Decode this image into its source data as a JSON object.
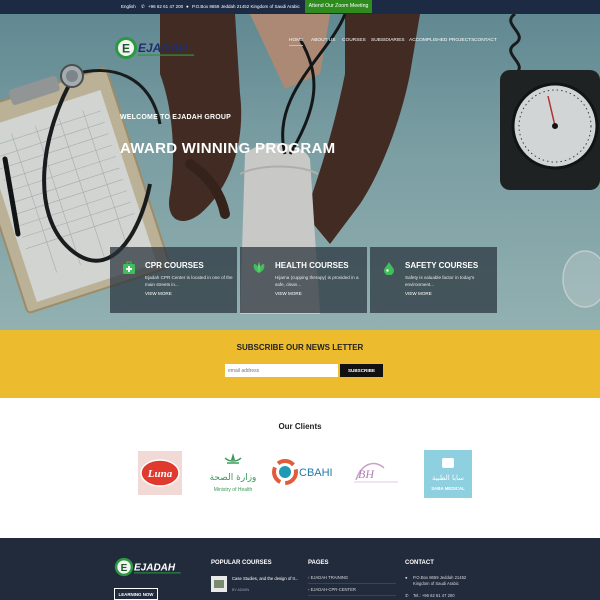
{
  "topbar": {
    "language": "English",
    "phone": "+96 62 61 47 200",
    "address": "P.O.Box 8659 Jeddah 21452 Kingdom of Saudi Arabic",
    "zoom_button": "Attend Our Zoom Meeting"
  },
  "brand": {
    "name": "EJADAH"
  },
  "nav": {
    "items": [
      {
        "label": "HOME"
      },
      {
        "label": "ABOUT US"
      },
      {
        "label": "COURSES"
      },
      {
        "label": "SUBSIDIARIES"
      },
      {
        "label": "ACCOMPLISHED PROJECTS"
      },
      {
        "label": "CONTACT"
      }
    ]
  },
  "hero": {
    "welcome": "WELCOME TO EJADAH GROUP",
    "headline": "AWARD WINNING PROGRAM"
  },
  "cards": [
    {
      "title": "CPR COURSES",
      "desc": "Ejadah CPR Center is located in one of the main streets in...",
      "more": "VIEW MORE",
      "icon": "first-aid-kit-icon"
    },
    {
      "title": "HEALTH COURSES",
      "desc": "Hijama (cupping therapy) is provided in a safe, clean...",
      "more": "VIEW MORE",
      "icon": "leaf-icon"
    },
    {
      "title": "SAFETY COURSES",
      "desc": "Safety is valuable factor in today's environment...",
      "more": "VIEW MORE",
      "icon": "drop-icon"
    }
  ],
  "newsletter": {
    "title": "SUBSCRIBE OUR NEWS LETTER",
    "placeholder": "email address",
    "button": "SUBSCRIBE"
  },
  "clients": {
    "title": "Our Clients",
    "logos": [
      {
        "label": "Luna"
      },
      {
        "label_ar": "وزارة الصحة",
        "label_en": "Ministry of Health"
      },
      {
        "label": "CBAHI"
      },
      {
        "label": "BH"
      },
      {
        "label_ar": "سابا الطبية",
        "label_en": "SABA MEDICAL"
      }
    ]
  },
  "footer": {
    "learn_button": "LEARNING NOW",
    "popular_title": "POPULAR COURSES",
    "popular_post": "Case Studies, and the design of tr...",
    "popular_author": "BY ADMIN",
    "pages_title": "PAGES",
    "pages": [
      "EJADAH TRAINING",
      "EJADAH-CPR-CENTER"
    ],
    "contact_title": "CONTACT",
    "contact_address_1": "P.O.Box 8659 Jeddah 21452",
    "contact_address_2": "Kingdom of Saudi Arabic",
    "contact_phone": "Tel.: +96 62 61 47 200"
  },
  "colors": {
    "accent_yellow": "#ecbb2e",
    "navy": "#1c2a44",
    "zoom_green": "#2e8b1e",
    "footer_bg": "#222b3b"
  }
}
